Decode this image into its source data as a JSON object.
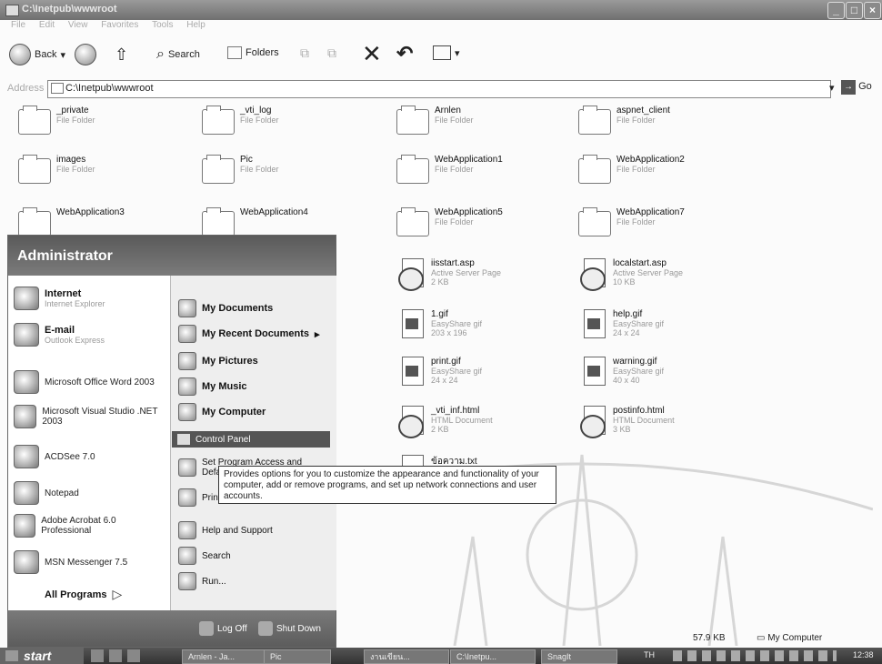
{
  "window": {
    "title": "C:\\Inetpub\\wwwroot"
  },
  "menubar": {
    "items": [
      "File",
      "Edit",
      "View",
      "Favorites",
      "Tools",
      "Help"
    ]
  },
  "toolbar": {
    "back_label": "Back",
    "search_label": "Search",
    "folders_label": "Folders"
  },
  "address": {
    "label": "Address",
    "value": "C:\\Inetpub\\wwwroot",
    "go_label": "Go"
  },
  "files": [
    {
      "name": "_private",
      "sub": "File Folder",
      "sub2": "",
      "type": "folder"
    },
    {
      "name": "_vti_log",
      "sub": "File Folder",
      "sub2": "",
      "type": "folder"
    },
    {
      "name": "Arnlen",
      "sub": "File Folder",
      "sub2": "",
      "type": "folder"
    },
    {
      "name": "aspnet_client",
      "sub": "File Folder",
      "sub2": "",
      "type": "folder"
    },
    {
      "name": "images",
      "sub": "File Folder",
      "sub2": "",
      "type": "folder"
    },
    {
      "name": "Pic",
      "sub": "File Folder",
      "sub2": "",
      "type": "folder"
    },
    {
      "name": "WebApplication1",
      "sub": "File Folder",
      "sub2": "",
      "type": "folder"
    },
    {
      "name": "WebApplication2",
      "sub": "File Folder",
      "sub2": "",
      "type": "folder"
    },
    {
      "name": "WebApplication3",
      "sub": "",
      "sub2": "",
      "type": "folder"
    },
    {
      "name": "WebApplication4",
      "sub": "",
      "sub2": "",
      "type": "folder"
    },
    {
      "name": "WebApplication5",
      "sub": "File Folder",
      "sub2": "",
      "type": "folder"
    },
    {
      "name": "WebApplication7",
      "sub": "File Folder",
      "sub2": "",
      "type": "folder"
    },
    {
      "name": "iisstart.asp",
      "sub": "Active Server Page",
      "sub2": "2 KB",
      "type": "asp"
    },
    {
      "name": "localstart.asp",
      "sub": "Active Server Page",
      "sub2": "10 KB",
      "type": "asp"
    },
    {
      "name": "1.gif",
      "sub": "EasyShare gif",
      "sub2": "203 x 196",
      "type": "gif"
    },
    {
      "name": "help.gif",
      "sub": "EasyShare gif",
      "sub2": "24 x 24",
      "type": "gif"
    },
    {
      "name": "print.gif",
      "sub": "EasyShare gif",
      "sub2": "24 x 24",
      "type": "gif"
    },
    {
      "name": "warning.gif",
      "sub": "EasyShare gif",
      "sub2": "40 x 40",
      "type": "gif"
    },
    {
      "name": "_vti_inf.html",
      "sub": "HTML Document",
      "sub2": "2 KB",
      "type": "html"
    },
    {
      "name": "postinfo.html",
      "sub": "HTML Document",
      "sub2": "3 KB",
      "type": "html"
    },
    {
      "name": "ข้อความ.txt",
      "sub": "",
      "sub2": "",
      "type": "txt"
    }
  ],
  "start_menu": {
    "user": "Administrator",
    "left": [
      {
        "title": "Internet",
        "sub": "Internet Explorer",
        "bold": true
      },
      {
        "title": "E-mail",
        "sub": "Outlook Express",
        "bold": true
      },
      {
        "title": "Microsoft Office Word 2003",
        "sub": "",
        "bold": false
      },
      {
        "title": "Microsoft Visual Studio .NET 2003",
        "sub": "",
        "bold": false
      },
      {
        "title": "ACDSee 7.0",
        "sub": "",
        "bold": false
      },
      {
        "title": "Notepad",
        "sub": "",
        "bold": false
      },
      {
        "title": "Adobe Acrobat 6.0 Professional",
        "sub": "",
        "bold": false
      },
      {
        "title": "MSN Messenger 7.5",
        "sub": "",
        "bold": false
      }
    ],
    "all_programs": "All Programs",
    "right": [
      {
        "title": "My Documents",
        "bold": true
      },
      {
        "title": "My Recent Documents",
        "bold": true
      },
      {
        "title": "My Pictures",
        "bold": true
      },
      {
        "title": "My Music",
        "bold": true
      },
      {
        "title": "My Computer",
        "bold": true
      },
      {
        "title": "Control Panel",
        "bold": false
      },
      {
        "title": "Set Program Access and Defaults",
        "bold": false
      },
      {
        "title": "Printers and Faxes",
        "bold": false
      },
      {
        "title": "Help and Support",
        "bold": false
      },
      {
        "title": "Search",
        "bold": false
      },
      {
        "title": "Run...",
        "bold": false
      }
    ],
    "log_off": "Log Off",
    "shut_down": "Shut Down"
  },
  "tooltip": "Provides options for you to customize the appearance and functionality of your computer, add or remove programs, and set up network connections and user accounts.",
  "status": {
    "size": "57.9 KB",
    "location": "My Computer"
  },
  "taskbar": {
    "start": "start",
    "buttons": [
      "Arnlen - Ja...",
      "Pic",
      "งานเขียน...",
      "C:\\Inetpu...",
      "SnagIt"
    ],
    "lang": "TH",
    "clock": "12:38"
  }
}
